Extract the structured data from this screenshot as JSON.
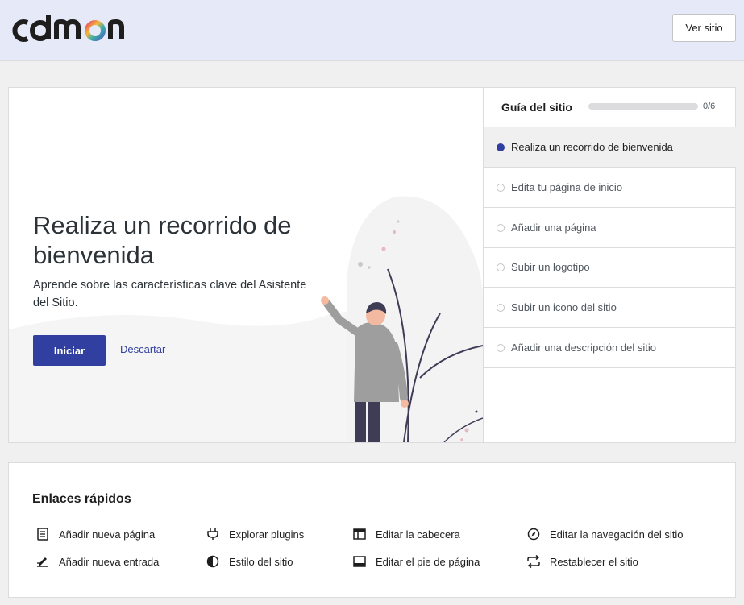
{
  "header": {
    "logo_text": "cdmon",
    "view_site_label": "Ver sitio"
  },
  "hero": {
    "title": "Realiza un recorrido de bienvenida",
    "description": "Aprende sobre las características clave del Asistente del Sitio.",
    "start_label": "Iniciar",
    "dismiss_label": "Descartar"
  },
  "guide": {
    "title": "Guía del sitio",
    "progress_text": "0/6",
    "progress_fraction": 0,
    "tasks": [
      {
        "label": "Realiza un recorrido de bienvenida",
        "active": true
      },
      {
        "label": "Edita tu página de inicio",
        "active": false
      },
      {
        "label": "Añadir una página",
        "active": false
      },
      {
        "label": "Subir un logotipo",
        "active": false
      },
      {
        "label": "Subir un icono del sitio",
        "active": false
      },
      {
        "label": "Añadir una descripción del sitio",
        "active": false
      }
    ]
  },
  "quick_links": {
    "title": "Enlaces rápidos",
    "items": [
      {
        "label": "Añadir nueva página",
        "icon": "page-icon"
      },
      {
        "label": "Añadir nueva entrada",
        "icon": "post-icon"
      },
      {
        "label": "Explorar plugins",
        "icon": "plugin-icon"
      },
      {
        "label": "Estilo del sitio",
        "icon": "contrast-icon"
      },
      {
        "label": "Editar la cabecera",
        "icon": "header-icon"
      },
      {
        "label": "Editar el pie de página",
        "icon": "footer-icon"
      },
      {
        "label": "Editar la navegación del sitio",
        "icon": "compass-icon"
      },
      {
        "label": "Restablecer el sitio",
        "icon": "reset-icon"
      }
    ]
  },
  "colors": {
    "accent": "#3140a0",
    "header_bg": "#e6e9f8",
    "page_bg": "#f0f0f1"
  }
}
